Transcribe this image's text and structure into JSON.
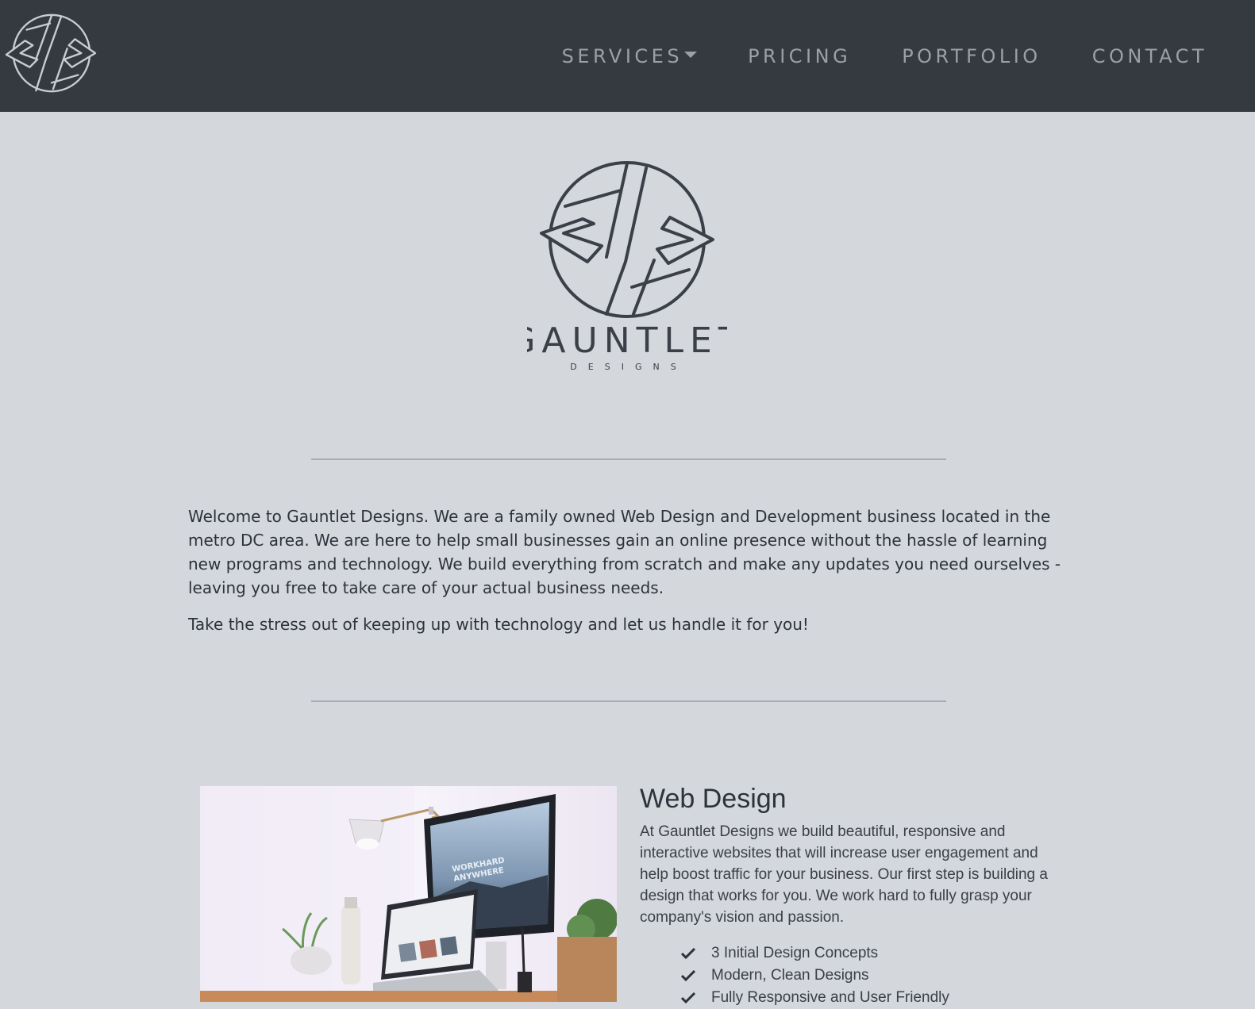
{
  "nav": {
    "logo_icon": "gauntlet-monogram-icon",
    "links": [
      {
        "label": "SERVICES",
        "has_dropdown": true
      },
      {
        "label": "PRICING"
      },
      {
        "label": "PORTFOLIO"
      },
      {
        "label": "CONTACT"
      }
    ]
  },
  "hero": {
    "brand_name": "GAUNTLET",
    "brand_tagline": "DESIGNS"
  },
  "intro": {
    "paragraph1": "Welcome to Gauntlet Designs. We are a family owned Web Design and Development business located in the metro DC area. We are here to help small businesses gain an online presence without the hassle of learning new programs and technology. We build everything from scratch and make any updates you need ourselves - leaving you free to take care of your actual business needs.",
    "paragraph2": "Take the stress out of keeping up with technology and let us handle it for you!"
  },
  "web_design": {
    "title": "Web Design",
    "description": "At Gauntlet Designs we build beautiful, responsive and interactive websites that will increase user engagement and help boost traffic for your business. Our first step is building a design that works for you. We work hard to fully grasp your company's vision and passion.",
    "image_text_line1": "WORKHARD",
    "image_text_line2": "ANYWHERE",
    "features": [
      "3 Initial Design Concepts",
      "Modern, Clean Designs",
      "Fully Responsive and User Friendly"
    ]
  },
  "colors": {
    "navbar_bg": "#353a41",
    "page_bg": "#d4d7dc",
    "nav_text": "#9aa0a8",
    "body_text": "#2d333b"
  }
}
